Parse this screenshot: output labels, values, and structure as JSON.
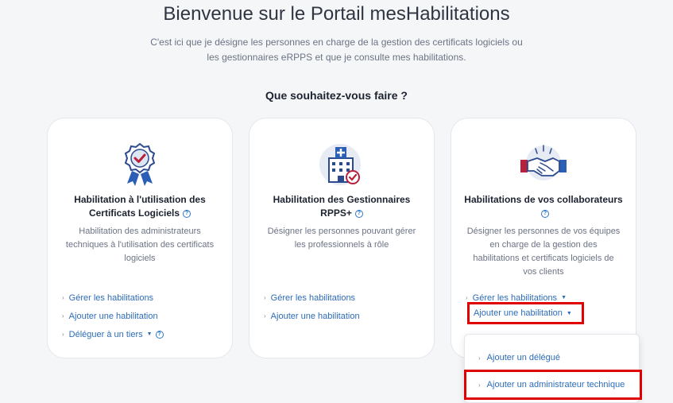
{
  "header": {
    "title": "Bienvenue sur le Portail mesHabilitations",
    "intro_line1": "C'est ici que je désigne les personnes en charge de la gestion des certificats logiciels ou",
    "intro_line2": "les gestionnaires eRPPS et que je consulte mes habilitations.",
    "question": "Que souhaitez-vous faire ?"
  },
  "cards": [
    {
      "icon": "award-badge-icon",
      "title_line1": "Habilitation à l'utilisation des",
      "title_line2": "Certificats Logiciels",
      "desc_lines": [
        "Habilitation des administrateurs",
        "techniques à l'utilisation des certificats",
        "logiciels"
      ],
      "links": [
        {
          "label": "Gérer les habilitations"
        },
        {
          "label": "Ajouter une habilitation"
        },
        {
          "label": "Déléguer à un tiers"
        }
      ]
    },
    {
      "icon": "hospital-building-icon",
      "title_line1": "Habilitation des Gestionnaires",
      "title_line2": "RPPS+",
      "desc_lines": [
        "Désigner les personnes pouvant gérer",
        "les professionnels à rôle"
      ],
      "links": [
        {
          "label": "Gérer les habilitations"
        },
        {
          "label": "Ajouter une habilitation"
        }
      ]
    },
    {
      "icon": "handshake-icon",
      "title_line1": "Habilitations de vos collaborateurs",
      "title_line2": "",
      "desc_lines": [
        "Désigner les personnes de vos équipes",
        "en charge de la gestion des",
        "habilitations et certificats logiciels de",
        "vos clients"
      ],
      "links": [
        {
          "label": "Gérer les habilitations"
        },
        {
          "label": "Ajouter une habilitation"
        }
      ]
    }
  ],
  "dropdown": {
    "items": [
      {
        "label": "Ajouter un délégué"
      },
      {
        "label": "Ajouter un administrateur technique"
      }
    ]
  },
  "colors": {
    "link": "#2d6cb8",
    "highlight": "#e00000",
    "accent_red": "#b8213c",
    "icon_blue": "#2b4a8f"
  }
}
